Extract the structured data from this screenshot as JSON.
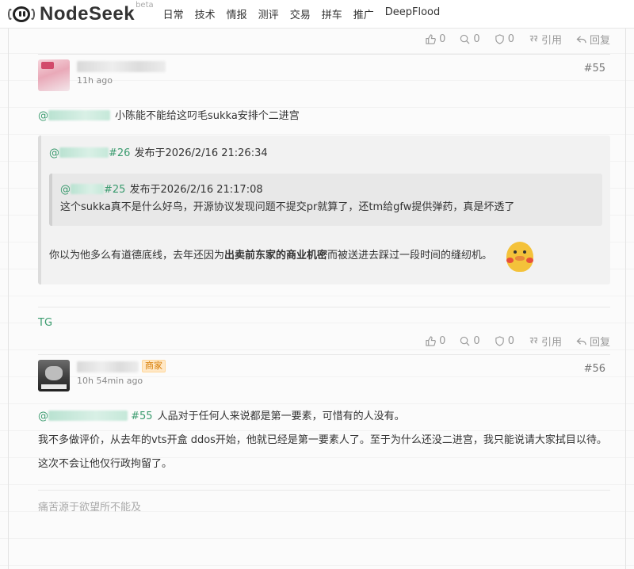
{
  "header": {
    "logo_text": "NodeSeek",
    "beta": "beta",
    "nav": [
      "日常",
      "技术",
      "情报",
      "测评",
      "交易",
      "拼车",
      "推广",
      "DeepFlood"
    ]
  },
  "actions": {
    "like_count": "0",
    "dislike_count": "0",
    "collect_count": "0",
    "quote_label": "引用",
    "reply_label": "回复"
  },
  "post55": {
    "time": "11h ago",
    "floor": "#55",
    "reply_text": "小陈能不能给这叼毛sukka安排个二进宫",
    "quote": {
      "ref_floor": "#26",
      "posted": "发布于2026/2/16 21:26:34",
      "inner": {
        "ref_floor": "#25",
        "posted": "发布于2026/2/16 21:17:08",
        "text": "这个sukka真不是什么好鸟，开源协议发现问题不提交pr就算了，还tm给gfw提供弹药，真是坏透了"
      },
      "text_before": "你以为他多么有道德底线，去年还因为",
      "text_bold": "出卖前东家的商业机密",
      "text_after": "而被送进去踩过一段时间的缝纫机。"
    },
    "signature": "TG"
  },
  "post56": {
    "badge": "商家",
    "time": "10h 54min ago",
    "floor": "#56",
    "ref_floor": "#55",
    "reply_text": "人品对于任何人来说都是第一要素，可惜有的人没有。",
    "para1": "我不多做评价，从去年的vts开盒 ddos开始，他就已经是第一要素人了。至于为什么还没二进宫，我只能说请大家拭目以待。",
    "para2": "这次不会让他仅行政拘留了。",
    "signature": "痛苦源于欲望所不能及"
  }
}
